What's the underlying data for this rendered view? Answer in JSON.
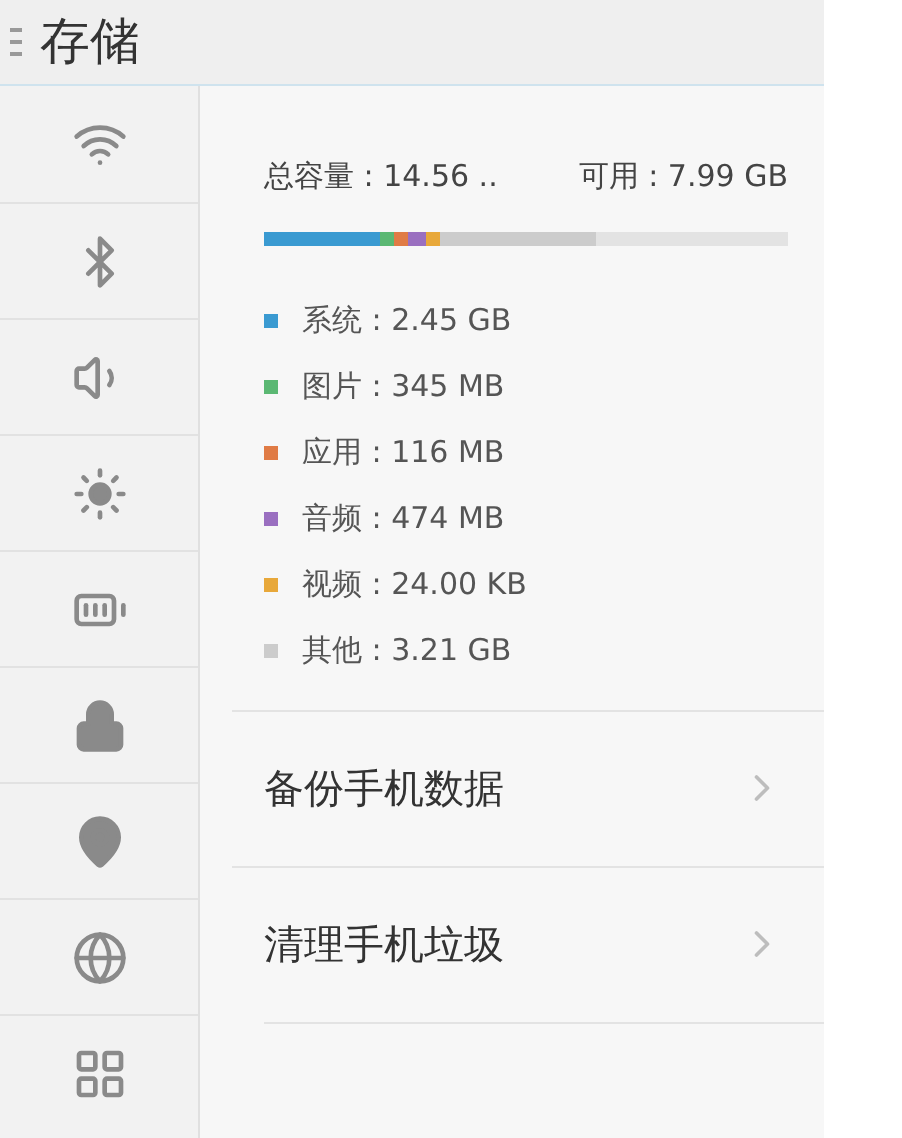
{
  "header": {
    "title": "存储"
  },
  "sidebar": {
    "items": [
      {
        "kind": "wifi"
      },
      {
        "kind": "bluetooth"
      },
      {
        "kind": "sound"
      },
      {
        "kind": "brightness"
      },
      {
        "kind": "battery"
      },
      {
        "kind": "lock"
      },
      {
        "kind": "location"
      },
      {
        "kind": "globe"
      },
      {
        "kind": "apps"
      }
    ]
  },
  "storage": {
    "total": "总容量 : 14.56 ..",
    "available": "可用 : 7.99 GB",
    "categories": [
      {
        "label": "系统 : 2.45 GB",
        "color": "#3a9ad1"
      },
      {
        "label": "图片 : 345 MB",
        "color": "#5bb873"
      },
      {
        "label": "应用 : 116 MB",
        "color": "#e07b45"
      },
      {
        "label": "音频 : 474 MB",
        "color": "#9a6fc0"
      },
      {
        "label": "视频 : 24.00 KB",
        "color": "#e8a83a"
      },
      {
        "label": "其他 : 3.21 GB",
        "color": "#cccccc"
      }
    ]
  },
  "actions": [
    {
      "label": "备份手机数据"
    },
    {
      "label": "清理手机垃圾"
    }
  ]
}
